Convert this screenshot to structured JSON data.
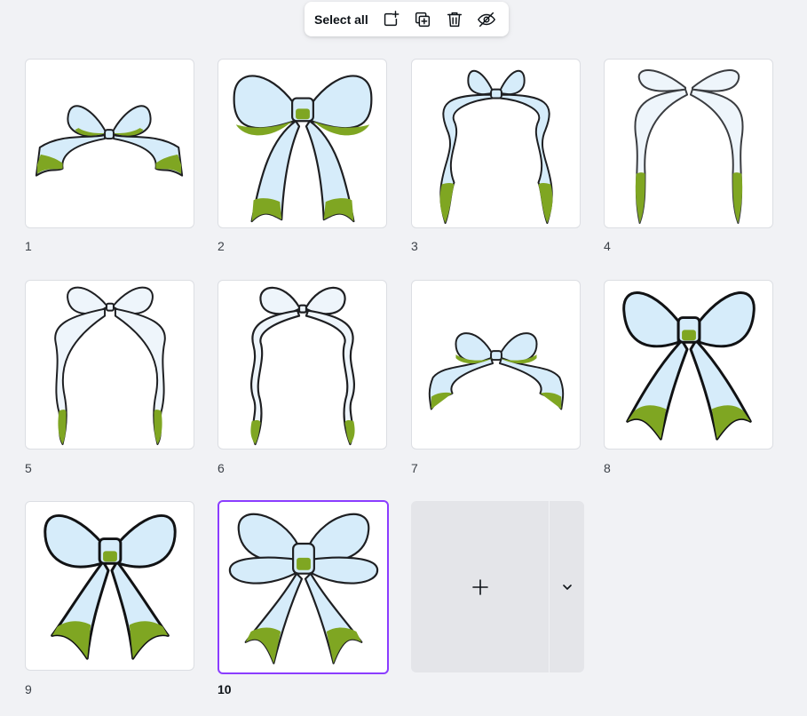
{
  "toolbar": {
    "select_all_label": "Select all",
    "icons": [
      "add-page-icon",
      "duplicate-icon",
      "trash-icon",
      "hide-icon"
    ]
  },
  "pages": [
    {
      "number": "1",
      "style": "small-bow"
    },
    {
      "number": "2",
      "style": "large-full-bow"
    },
    {
      "number": "3",
      "style": "long-wavy-tails"
    },
    {
      "number": "4",
      "style": "outline-long-tails"
    },
    {
      "number": "5",
      "style": "outline-wavy-tails"
    },
    {
      "number": "6",
      "style": "outline-wavy-tails-2"
    },
    {
      "number": "7",
      "style": "small-bow-2"
    },
    {
      "number": "8",
      "style": "bold-bow"
    },
    {
      "number": "9",
      "style": "bold-bow-2"
    },
    {
      "number": "10",
      "style": "bow-selected"
    }
  ],
  "selected_page": "10",
  "colors": {
    "accent": "#8b3dff",
    "bow_light": "#cfe8f8",
    "bow_green": "#7fa622",
    "outline": "#1e1f22"
  }
}
